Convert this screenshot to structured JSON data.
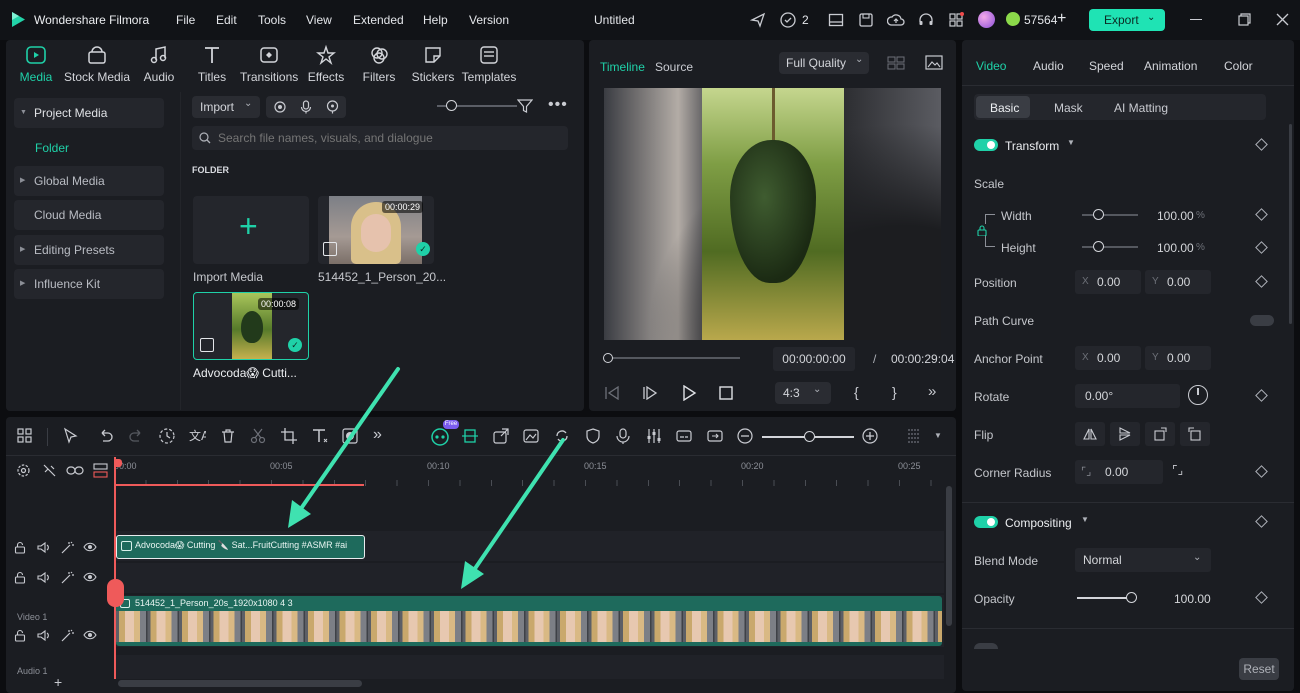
{
  "app": {
    "name": "Wondershare Filmora",
    "doc_title": "Untitled",
    "credits": "57564",
    "export_label": "Export",
    "count_badge": "2"
  },
  "menu": [
    "File",
    "Edit",
    "Tools",
    "View",
    "Extended",
    "Help",
    "Version"
  ],
  "toolbar": [
    "Media",
    "Stock Media",
    "Audio",
    "Titles",
    "Transitions",
    "Effects",
    "Filters",
    "Stickers",
    "Templates"
  ],
  "sidebar": {
    "items": [
      "Project Media",
      "Folder",
      "Global Media",
      "Cloud Media",
      "Editing Presets",
      "Influence Kit"
    ]
  },
  "media": {
    "import_label": "Import",
    "search_placeholder": "Search file names, visuals, and dialogue",
    "folder_label": "FOLDER",
    "import_media_label": "Import Media",
    "clip1_name": "514452_1_Person_20...",
    "clip1_duration": "00:00:29",
    "clip2_name": "Advocoda😱 Cutti...",
    "clip2_duration": "00:00:08"
  },
  "player": {
    "tab_timeline": "Timeline",
    "tab_source": "Source",
    "quality": "Full Quality",
    "current_time": "00:00:00:00",
    "separator": "/",
    "total_time": "00:00:29:04",
    "aspect": "4:3"
  },
  "props": {
    "tabs": [
      "Video",
      "Audio",
      "Speed",
      "Animation",
      "Color"
    ],
    "subtabs": [
      "Basic",
      "Mask",
      "AI Matting"
    ],
    "transform": "Transform",
    "scale": "Scale",
    "width": "Width",
    "width_val": "100.00",
    "height": "Height",
    "height_val": "100.00",
    "pct": "%",
    "position": "Position",
    "x": "X",
    "y": "Y",
    "pos_x": "0.00",
    "pos_y": "0.00",
    "path_curve": "Path Curve",
    "anchor_point": "Anchor Point",
    "anchor_x": "0.00",
    "anchor_y": "0.00",
    "rotate": "Rotate",
    "rotate_val": "0.00°",
    "flip": "Flip",
    "corner_radius": "Corner Radius",
    "corner_val": "0.00",
    "compositing": "Compositing",
    "blend_mode": "Blend Mode",
    "blend_val": "Normal",
    "opacity": "Opacity",
    "opacity_val": "100.00",
    "reset": "Reset"
  },
  "timeline": {
    "ruler": [
      "00:00",
      "00:05",
      "00:10",
      "00:15",
      "00:20",
      "00:25"
    ],
    "clip_top_label": "Advocoda😱 Cutting 🔪 Sat...FruitCutting #ASMR #ai",
    "clip_main_label": "514452_1_Person_20s_1920x1080 4 3",
    "video_track": "Video 1",
    "audio_track": "Audio 1",
    "free_badge": "Free"
  },
  "colors": {
    "accent": "#1fd1a8",
    "clip": "#1e6a5c",
    "playhead": "#ef5a5a",
    "arrow": "#3fe2b0",
    "export_bg": "#1fe3b4"
  }
}
